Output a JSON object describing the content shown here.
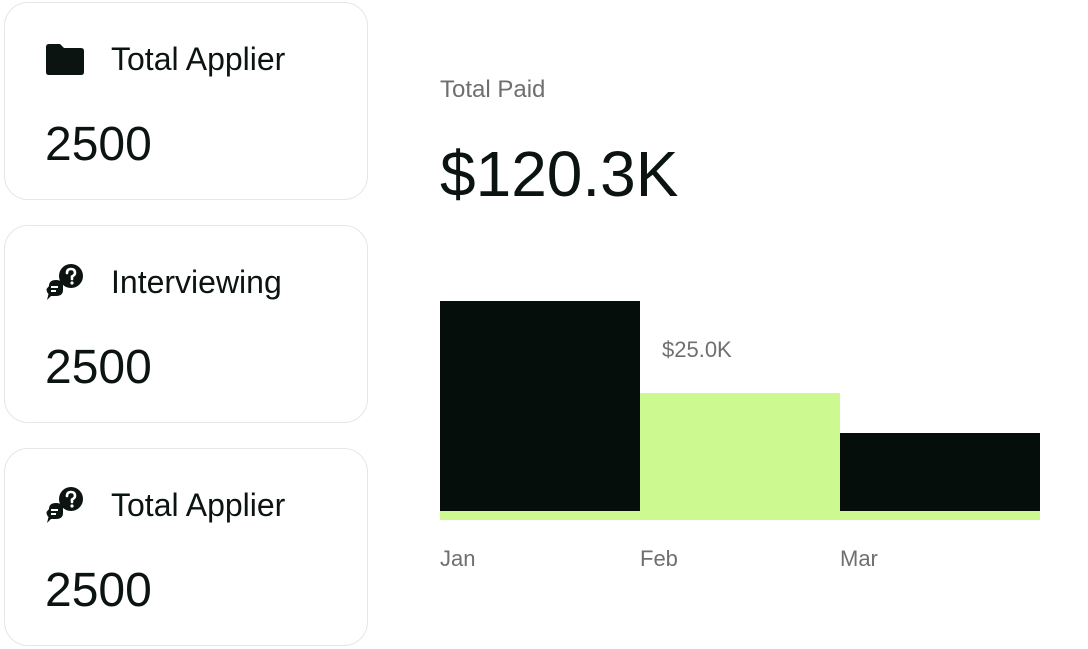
{
  "cards": [
    {
      "icon": "folder-icon",
      "title": "Total Applier",
      "value": "2500"
    },
    {
      "icon": "chat-question-icon",
      "title": "Interviewing",
      "value": "2500"
    },
    {
      "icon": "chat-question-icon",
      "title": "Total Applier",
      "value": "2500"
    }
  ],
  "summary": {
    "label": "Total Paid",
    "value": "$120.3K"
  },
  "colors": {
    "dark": "#050e0a",
    "accent": "#ccf990",
    "muted": "#6f6f6f"
  },
  "chart_data": {
    "type": "bar",
    "categories": [
      "Jan",
      "Feb",
      "Mar"
    ],
    "values": [
      52.5,
      29.5,
      19.5
    ],
    "value_unit": "$K",
    "bar_colors": [
      "#050e0a",
      "#ccf990",
      "#050e0a"
    ],
    "annotations": [
      {
        "category": "Feb",
        "label": "$25.0K"
      }
    ],
    "baseline_color": "#ccf990",
    "ylim": [
      0,
      60
    ],
    "grid": false,
    "legend": "none"
  }
}
